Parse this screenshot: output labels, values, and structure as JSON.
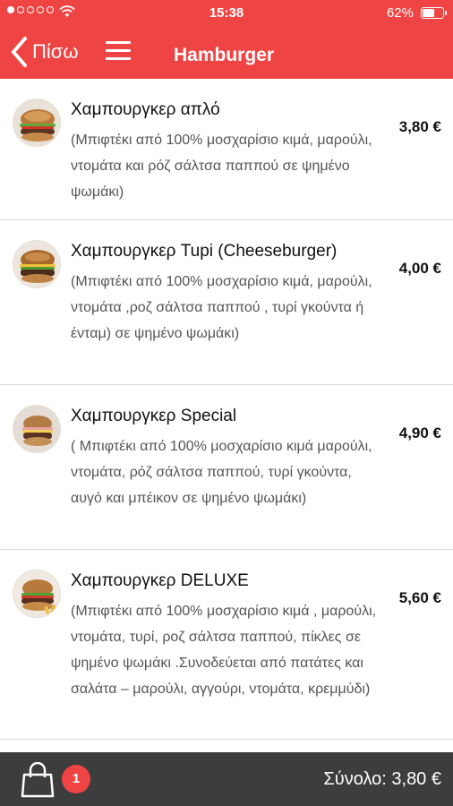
{
  "status_bar": {
    "time": "15:38",
    "battery_percent": "62%",
    "battery_level": 0.62,
    "signal_bars_filled": 1,
    "signal_bars_total": 5
  },
  "nav": {
    "back_label": "Πίσω",
    "title": "Hamburger"
  },
  "items": [
    {
      "title": "Χαμπουργκερ απλό",
      "description": "(Μπιφτέκι από 100% μοσχαρίσιο κιμά, μαρούλι, ντομάτα και ρόζ σάλτσα παππού σε ψημένο ψωμάκι)",
      "price": "3,80 €"
    },
    {
      "title": "Χαμπουργκερ Tupi (Cheeseburger)",
      "description": "(Μπιφτέκι από 100% μοσχαρίσιο κιμά, μαρούλι, ντομάτα ,ροζ σάλτσα παππού , τυρί γκούντα ή ένταμ) σε ψημένο ψωμάκι)",
      "price": "4,00 €"
    },
    {
      "title": "Χαμπουργκερ Special",
      "description": "( Μπιφτέκι από 100% μοσχαρίσιο κιμά μαρούλι, ντομάτα, ρόζ σάλτσα παππού, τυρί γκούντα, αυγό και μπέικον σε ψημένο ψωμάκι)",
      "price": "4,90 €"
    },
    {
      "title": "Χαμπουργκερ DELUXE",
      "description": "(Μπιφτέκι από 100% μοσχαρίσιο κιμά , μαρούλι, ντομάτα, τυρί, ροζ σάλτσα παππού, πίκλες σε ψημένο ψωμάκι .Συνοδεύεται από πατάτες και σαλάτα – μαρούλι, αγγούρι, ντομάτα, κρεμμύδι)",
      "price": "5,60 €"
    }
  ],
  "footer": {
    "cart_count": "1",
    "total_label": "Σύνολο: 3,80 €"
  },
  "colors": {
    "accent": "#ef4444",
    "footer_bg": "#3d3d3d"
  },
  "icons": [
    "back-chevron-icon",
    "menu-icon",
    "burger-photo",
    "shopping-bag-icon",
    "wifi-icon",
    "battery-icon"
  ]
}
